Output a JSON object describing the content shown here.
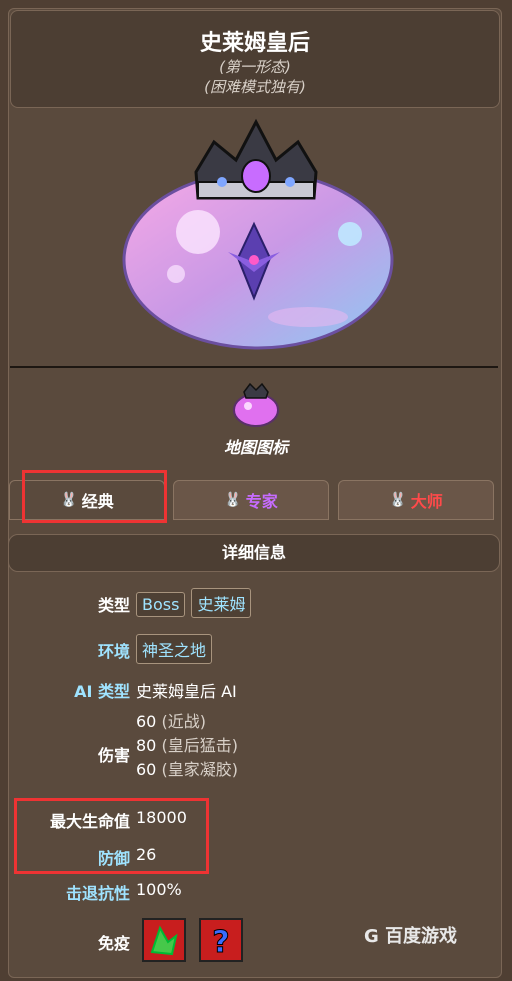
{
  "header": {
    "title": "史莱姆皇后",
    "subtitle1": "(第一形态)",
    "subtitle2": "(困难模式独有)"
  },
  "map_icon_label": "地图图标",
  "tabs": [
    {
      "label": "经典",
      "color": "#ffffff"
    },
    {
      "label": "专家",
      "color": "#c66cff"
    },
    {
      "label": "大师",
      "color": "#ff4a4a"
    }
  ],
  "detail_header": "详细信息",
  "info": {
    "type_label": "类型",
    "type_tags": [
      "Boss",
      "史莱姆"
    ],
    "env_label": "环境",
    "env_tag": "神圣之地",
    "ai_label": "AI 类型",
    "ai_value": "史莱姆皇后 AI",
    "damage_label": "伤害",
    "damage_lines": [
      {
        "value": "60",
        "note": "(近战)"
      },
      {
        "value": "80",
        "note": "(皇后猛击)"
      },
      {
        "value": "60",
        "note": "(皇家凝胶)"
      }
    ],
    "hp_label": "最大生命值",
    "hp_value": "18000",
    "def_label": "防御",
    "def_value": "26",
    "kb_label": "击退抗性",
    "kb_value": "100%",
    "immune_label": "免疫"
  },
  "watermark": "百度游戏",
  "colors": {
    "accent_label": "#9fe3ff",
    "highlight_red": "#e33333"
  }
}
